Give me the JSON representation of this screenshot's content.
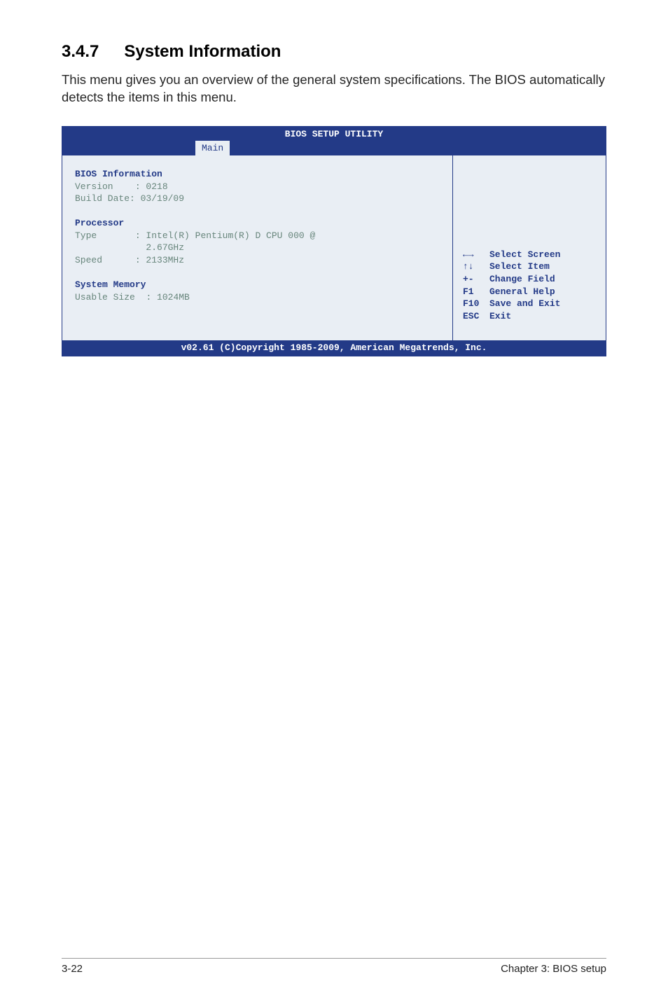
{
  "heading": {
    "num": "3.4.7",
    "title": "System Information"
  },
  "intro": "This menu gives you an overview of the general system specifications. The BIOS automatically detects the items in this menu.",
  "bios": {
    "title": "BIOS SETUP UTILITY",
    "tab": "Main",
    "sections": {
      "biosinfo": {
        "header": "BIOS Information",
        "version_label": "Version",
        "version_value": ": 0218",
        "build_label": "Build Date",
        "build_value": ": 03/19/09"
      },
      "processor": {
        "header": "Processor",
        "type_label": "Type",
        "type_value": ": Intel(R) Pentium(R) D CPU 000 @",
        "type_value2": "2.67GHz",
        "speed_label": "Speed",
        "speed_value": ": 2133MHz"
      },
      "memory": {
        "header": "System Memory",
        "usable_label": "Usable Size",
        "usable_value": ": 1024MB"
      }
    },
    "help": [
      {
        "key": "←→",
        "desc": "Select Screen"
      },
      {
        "key": "↑↓",
        "desc": "Select Item"
      },
      {
        "key": "+-",
        "desc": "Change Field"
      },
      {
        "key": "F1",
        "desc": "General Help"
      },
      {
        "key": "F10",
        "desc": "Save and Exit"
      },
      {
        "key": "ESC",
        "desc": "Exit"
      }
    ],
    "footer": "v02.61 (C)Copyright 1985-2009, American Megatrends, Inc."
  },
  "pagefooter": {
    "left": "3-22",
    "right": "Chapter 3: BIOS setup"
  }
}
